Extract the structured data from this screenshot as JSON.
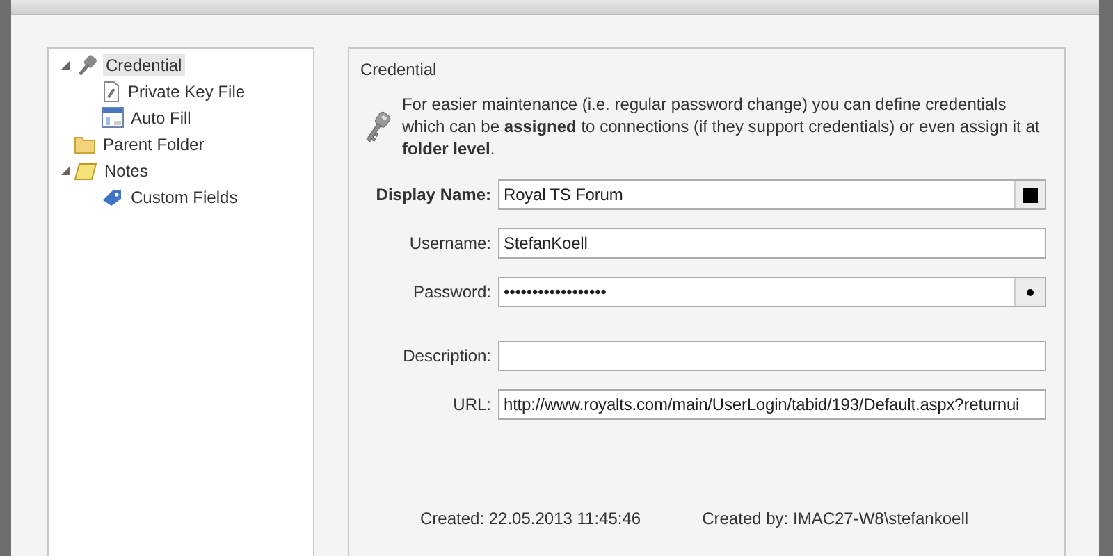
{
  "tree": [
    {
      "label": "Credential",
      "kind": "key",
      "selected": true,
      "expanded": true,
      "children": [
        {
          "label": "Private Key File",
          "kind": "document",
          "selected": false
        },
        {
          "label": "Auto Fill",
          "kind": "form",
          "selected": false
        }
      ]
    },
    {
      "label": "Parent Folder",
      "kind": "folder",
      "selected": false
    },
    {
      "label": "Notes",
      "kind": "note",
      "selected": false,
      "expanded": true,
      "children": [
        {
          "label": "Custom Fields",
          "kind": "tag",
          "selected": false
        }
      ]
    }
  ],
  "panel": {
    "title": "Credential",
    "description": "For easier maintenance (i.e. regular password change) you can define credentials which can be **assigned** to connections (if they support credentials) or even assign it at **folder level**.",
    "field_groups": [
      [
        {
          "label": "Display Name:",
          "value": "Royal TS Forum",
          "bold": true,
          "kind": "color"
        },
        {
          "label": "Username:",
          "value": "StefanKoell",
          "bold": false,
          "kind": "text"
        },
        {
          "label": "Password:",
          "value": "••••••••••••••••••",
          "bold": false,
          "kind": "password"
        }
      ],
      [
        {
          "label": "Description:",
          "bold": false,
          "kind": "text"
        },
        {
          "label": "URL:",
          "value": "http://www.royalts.com/main/UserLogin/tabid/193/Default.aspx?returnui",
          "bold": false,
          "kind": "text"
        }
      ]
    ],
    "footer": [
      {
        "label": "Created:",
        "value": "22.05.2013 11:45:46"
      },
      {
        "label": "Created by:",
        "value": "IMAC27-W8\\stefankoell"
      }
    ]
  }
}
